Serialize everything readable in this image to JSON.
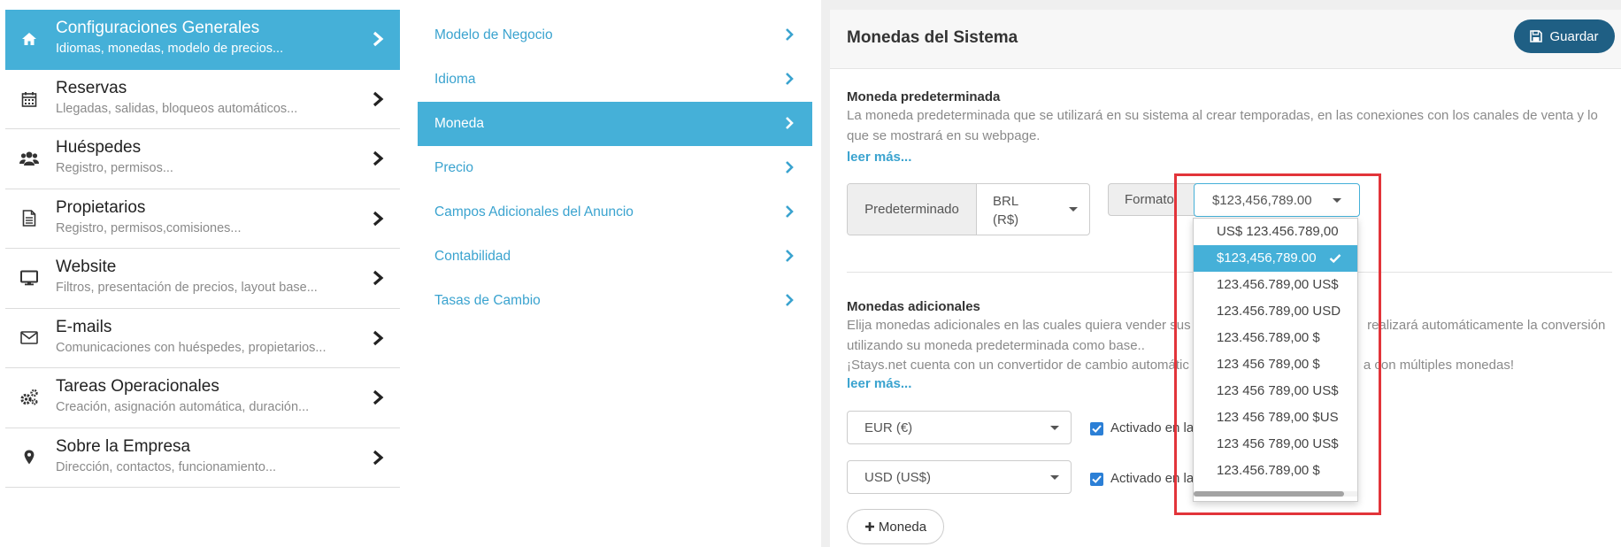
{
  "nav": {
    "items": [
      {
        "title": "Configuraciones Generales",
        "subtitle": "Idiomas, monedas, modelo de precios...",
        "icon": "home-icon"
      },
      {
        "title": "Reservas",
        "subtitle": "Llegadas, salidas, bloqueos automáticos...",
        "icon": "calendar-icon"
      },
      {
        "title": "Huéspedes",
        "subtitle": "Registro, permisos...",
        "icon": "users-icon"
      },
      {
        "title": "Propietarios",
        "subtitle": "Registro, permisos,comisiones...",
        "icon": "document-icon"
      },
      {
        "title": "Website",
        "subtitle": "Filtros, presentación de precios, layout base...",
        "icon": "monitor-icon"
      },
      {
        "title": "E-mails",
        "subtitle": "Comunicaciones con huéspedes, propietarios...",
        "icon": "envelope-icon"
      },
      {
        "title": "Tareas Operacionales",
        "subtitle": "Creación, asignación automática, duración...",
        "icon": "gears-icon"
      },
      {
        "title": "Sobre la Empresa",
        "subtitle": "Dirección, contactos, funcionamiento...",
        "icon": "map-pin-icon"
      }
    ]
  },
  "menu": {
    "items": [
      {
        "label": "Modelo de Negocio"
      },
      {
        "label": "Idioma"
      },
      {
        "label": "Moneda"
      },
      {
        "label": "Precio"
      },
      {
        "label": "Campos Adicionales del Anuncio"
      },
      {
        "label": "Contabilidad"
      },
      {
        "label": "Tasas de Cambio"
      }
    ]
  },
  "panel": {
    "title": "Monedas del Sistema",
    "save_label": "Guardar",
    "default_currency": {
      "title": "Moneda predeterminada",
      "text_line1": "La moneda predeterminada que se utilizará en su sistema al crear temporadas, en las conexiones con los canales de venta y lo",
      "text_line2": "que se mostrará en su webpage.",
      "read_more": "leer más...",
      "label": "Predeterminado",
      "value_line1": "BRL",
      "value_line2": "(R$)",
      "format_label": "Formato",
      "format_value": "$123,456,789.00"
    },
    "additional": {
      "title": "Monedas adicionales",
      "text_line1a": "Elija monedas adicionales en las cuales quiera vender sus p",
      "text_line1b": "realizará automáticamente la conversión",
      "text_line2": "utilizando su moneda predeterminada como base..",
      "text_line3a": "¡Stays.net cuenta con un convertidor de cambio automátic",
      "text_line3b": "a con múltiples monedas!",
      "read_more": "leer más...",
      "currencies": [
        {
          "value": "EUR (€)",
          "active_label": "Activado en la"
        },
        {
          "value": "USD (US$)",
          "active_label": "Activado en la"
        }
      ],
      "add_label": "Moneda"
    }
  },
  "format_dropdown": {
    "options": [
      "US$ 123.456.789,00",
      "$123,456,789.00",
      "123.456.789,00 US$",
      "123.456.789,00 USD",
      "123.456.789,00 $",
      "123 456 789,00 $",
      "123 456 789,00 US$",
      "123 456 789,00 $US",
      "123 456 789,00 US$",
      "123.456.789,00 $"
    ],
    "selected_index": 1
  },
  "colors": {
    "accent": "#45b0d8",
    "save_button": "#1f5f84",
    "link": "#3aa3cf",
    "highlight": "#e2343a",
    "checkbox": "#2b7fd6"
  }
}
